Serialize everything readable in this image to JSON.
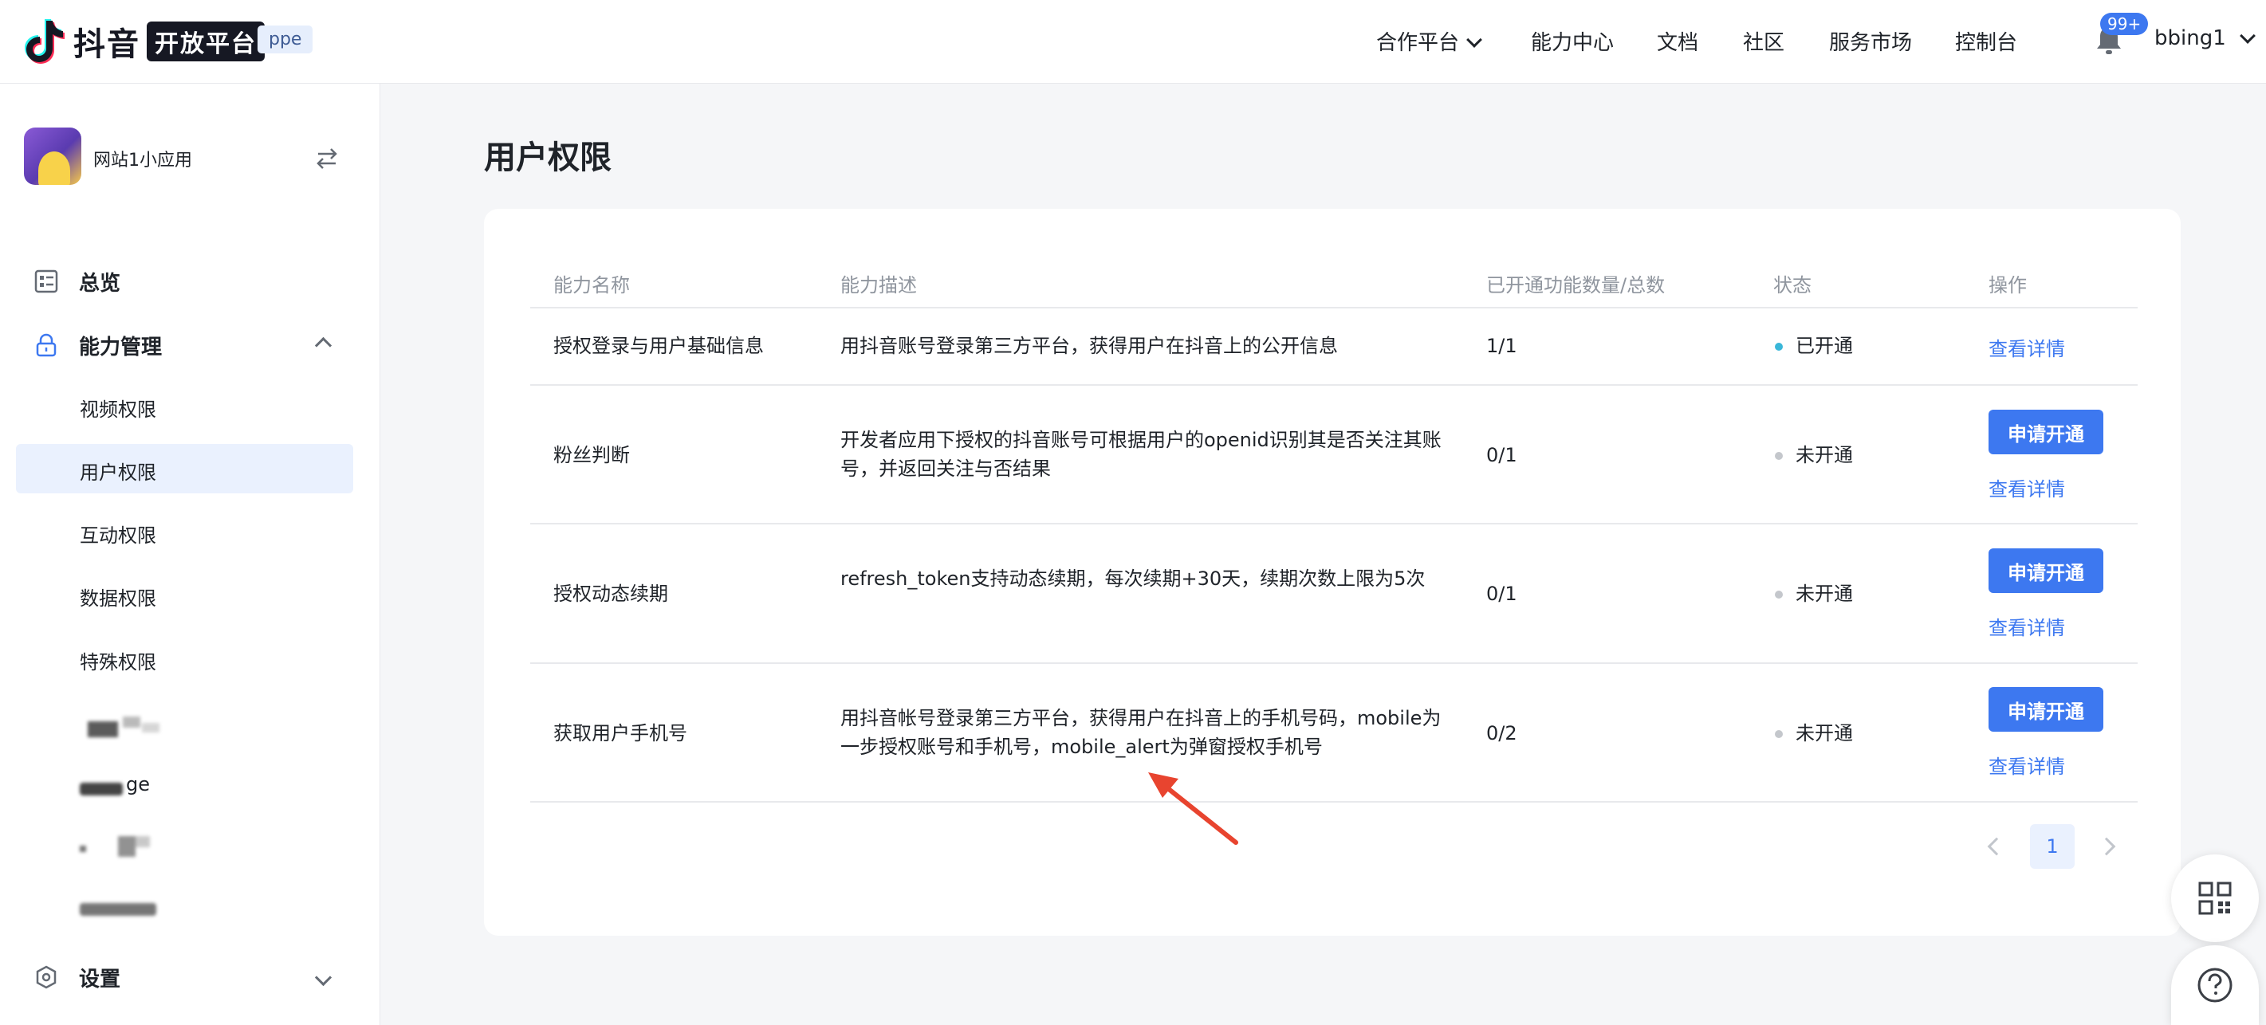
{
  "header": {
    "logo_text": "抖音",
    "logo_box": "开放平台",
    "env": "ppe",
    "nav": [
      {
        "label": "合作平台",
        "has_dropdown": true
      },
      {
        "label": "能力中心"
      },
      {
        "label": "文档"
      },
      {
        "label": "社区"
      },
      {
        "label": "服务市场"
      },
      {
        "label": "控制台"
      }
    ],
    "notification_count": "99+",
    "username": "bbing1"
  },
  "sidebar": {
    "app_name": "网站1小应用",
    "overview": "总览",
    "capability": "能力管理",
    "sub_items": [
      "视频权限",
      "用户权限",
      "互动权限",
      "数据权限",
      "特殊权限"
    ],
    "blurred_partial": "ge",
    "settings": "设置"
  },
  "main": {
    "title": "用户权限",
    "table": {
      "headers": [
        "能力名称",
        "能力描述",
        "已开通功能数量/总数",
        "状态",
        "操作"
      ],
      "rows": [
        {
          "name": "授权登录与用户基础信息",
          "desc": "用抖音账号登录第三方平台，获得用户在抖音上的公开信息",
          "count": "1/1",
          "status": "已开通",
          "status_color": "#3ab7d9",
          "apply": "",
          "detail": "查看详情"
        },
        {
          "name": "粉丝判断",
          "desc": "开发者应用下授权的抖音账号可根据用户的openid识别其是否关注其账号，并返回关注与否结果",
          "count": "0/1",
          "status": "未开通",
          "status_color": "#c4c7cc",
          "apply": "申请开通",
          "detail": "查看详情"
        },
        {
          "name": "授权动态续期",
          "desc": "refresh_token支持动态续期，每次续期+30天，续期次数上限为5次",
          "count": "0/1",
          "status": "未开通",
          "status_color": "#c4c7cc",
          "apply": "申请开通",
          "detail": "查看详情"
        },
        {
          "name": "获取用户手机号",
          "desc": "用抖音帐号登录第三方平台，获得用户在抖音上的手机号码，mobile为一步授权账号和手机号，mobile_alert为弹窗授权手机号",
          "count": "0/2",
          "status": "未开通",
          "status_color": "#c4c7cc",
          "apply": "申请开通",
          "detail": "查看详情"
        }
      ]
    },
    "pagination": {
      "current": "1"
    }
  },
  "colors": {
    "primary": "#3d78f0",
    "annotation_arrow": "#e8442f"
  }
}
